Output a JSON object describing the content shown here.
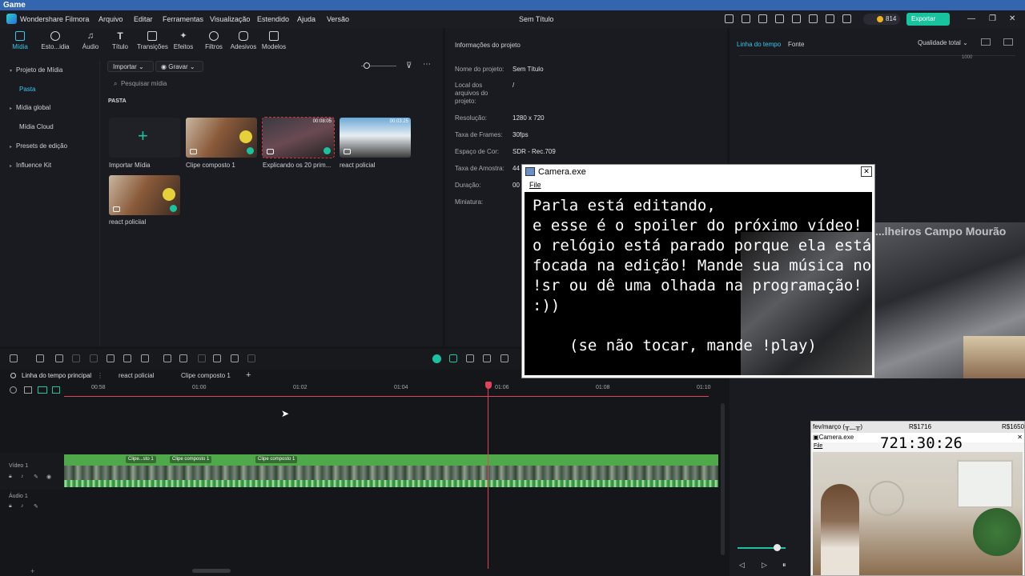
{
  "game_bar": {
    "title": "Game"
  },
  "app": {
    "name": "Wondershare Filmora",
    "window_title": "Sem Título",
    "menus": [
      "Arquivo",
      "Editar",
      "Ferramentas",
      "Visualização",
      "Estendido",
      "Ajuda",
      "Versão"
    ],
    "credits": "814",
    "export_label": "Exportar"
  },
  "top_tabs": [
    {
      "label": "Mídia",
      "icon": "media-icon",
      "active": true
    },
    {
      "label": "Esto...idia",
      "icon": "stock-media-icon"
    },
    {
      "label": "Áudio",
      "icon": "music-note-icon"
    },
    {
      "label": "Título",
      "icon": "text-icon"
    },
    {
      "label": "Transições",
      "icon": "transition-icon"
    },
    {
      "label": "Efeitos",
      "icon": "effects-icon"
    },
    {
      "label": "Filtros",
      "icon": "filter-icon"
    },
    {
      "label": "Adesivos",
      "icon": "sticker-icon"
    },
    {
      "label": "Modelos",
      "icon": "template-icon"
    }
  ],
  "sidebar": {
    "items": [
      {
        "label": "Projeto de Mídia",
        "arrow": "▾"
      },
      {
        "label": "Pasta",
        "active": true
      },
      {
        "label": "Mídia global",
        "arrow": "▸"
      },
      {
        "label": "Mídia Cloud"
      },
      {
        "label": "Presets de edição",
        "arrow": "▸"
      },
      {
        "label": "Influence Kit",
        "arrow": "▸"
      }
    ]
  },
  "media": {
    "import_label": "Importar",
    "record_label": "Gravar",
    "search_placeholder": "Pesquisar mídia",
    "folder_label": "PASTA",
    "items": [
      {
        "label": "Importar Mídia",
        "duration": ""
      },
      {
        "label": "Clipe composto 1",
        "duration": ""
      },
      {
        "label": "Explicando os 20 prim...",
        "duration": "00:08:05"
      },
      {
        "label": "react policial",
        "duration": "00:03:25"
      },
      {
        "label": "react policiial",
        "duration": ""
      }
    ]
  },
  "project_info": {
    "title": "Informações do projeto",
    "rows": [
      {
        "label": "Nome do projeto:",
        "value": "Sem Título"
      },
      {
        "label": "Local dos arquivos do projeto:",
        "value": "/"
      },
      {
        "label": "Resolução:",
        "value": "1280 x 720"
      },
      {
        "label": "Taxa de Frames:",
        "value": "30fps"
      },
      {
        "label": "Espaço de Cor:",
        "value": "SDR - Rec.709"
      },
      {
        "label": "Taxa de Amostra:",
        "value": "44"
      },
      {
        "label": "Duração:",
        "value": "00"
      },
      {
        "label": "Miniatura:",
        "value": ""
      }
    ]
  },
  "player": {
    "tab_timeline": "Linha do tempo",
    "tab_source": "Fonte",
    "quality": "Qualidade total",
    "ruler_label": "1000"
  },
  "timeline": {
    "tabs": [
      "Linha do tempo principal",
      "react policial",
      "Clipe composto 1"
    ],
    "ruler": [
      "00:58",
      "01:00",
      "01:02",
      "01:04",
      "01:06",
      "01:08",
      "01:10"
    ],
    "track_video": "Vídeo 1",
    "track_audio": "Áudio 1",
    "clip_labels": [
      "Clipe...sto 1",
      "Clipe composto 1",
      "Clipe composto 1"
    ]
  },
  "camera_window": {
    "title": "Camera.exe",
    "menu": "File",
    "message": "Parla está editando,\ne esse é o spoiler do próximo vídeo!\no relógio está parado porque ela está\nfocada na edição! Mande sua música no\n!sr ou dê uma olhada na programação!\n:))",
    "message2": "(se não tocar, mande !play)"
  },
  "stream": {
    "banner": "...lheiros Campo Mourão"
  },
  "camera_window2": {
    "header_left": "fev/março (╥﹏╥)",
    "header_mid": "R$1716",
    "header_right": "R$1650",
    "title": "Camera.exe",
    "menu": "File",
    "clock": "721:30:26"
  }
}
